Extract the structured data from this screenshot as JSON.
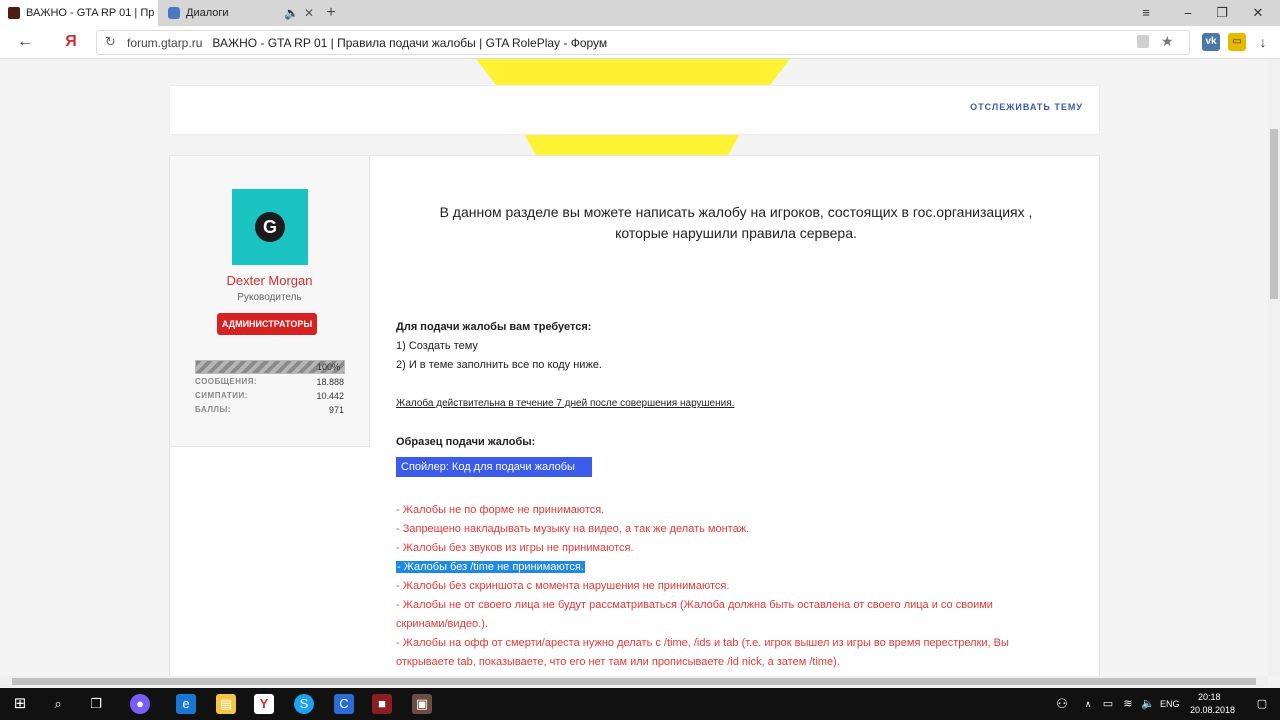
{
  "browser": {
    "tabs": [
      {
        "title": "ВАЖНО - GTA RP 01 | Пр"
      },
      {
        "title": "Диалоги"
      }
    ],
    "new_tab": "+",
    "window": {
      "min": "⎯",
      "restore": "❐",
      "close": "✕",
      "menu": "≡"
    },
    "back": "←",
    "yandex_logo": "Я",
    "url_domain": "forum.gtarp.ru",
    "url_title": "ВАЖНО - GTA RP 01 | Правила подачи жалобы | GTA RolePlay - Форум",
    "download": "↓",
    "ext_vk": "vk"
  },
  "page": {
    "follow_label": "ОТСЛЕЖИВАТЬ ТЕМУ",
    "author": {
      "name": "Dexter Morgan",
      "role": "Руководитель",
      "badge": "АДМИНИСТРАТОРЫ",
      "avatar_letter": "G",
      "progress_percent": 100,
      "progress_label": "100%",
      "stats": [
        {
          "label": "СООБЩЕНИЯ:",
          "value": "18.888"
        },
        {
          "label": "СИМПАТИИ:",
          "value": "10.442"
        },
        {
          "label": "БАЛЛЫ:",
          "value": "971"
        }
      ]
    },
    "headline_1": "В данном разделе вы можете написать жалобу на игроков, состоящих в гос.организациях ,",
    "headline_2": "которые нарушили правила сервера.",
    "req_title": "Для подачи жалобы вам требуется:",
    "req_1": "1) Создать тему",
    "req_2": "2) И в теме заполнить все по коду ниже.",
    "validity": "Жалоба действительна в течение 7 дней после совершения нарушения.",
    "sample_title": "Образец подачи жалобы:",
    "spoiler": "Спойлер: Код для подачи жалобы",
    "rules": {
      "r1": "- Жалобы не по форме не принимаются.",
      "r2": "- Запрещено накладывать музыку на видео, а так же делать монтаж.",
      "r3": "- Жалобы без звуков из игры не принимаются.",
      "r4": "- Жалобы без /time не принимаются.",
      "r5": "- Жалобы без скриншота с момента нарушения не принимаются.",
      "r6a": "- Жалобы не от своего лица не будут рассматриваться (Жалоба должна быть оставлена от своего лица и со своими",
      "r6b": "скринами/видео.).",
      "r7a": "- Жалобы на офф от смерти/ареста нужно делать с /time, /ids и tab (т.е. игрок вышел из игры во время перестрелки, Вы",
      "r7b": "открываете tab, показываете, что его нет там или прописываете /id nick, а затем /time)."
    }
  },
  "taskbar": {
    "lang": "ENG",
    "time": "20:18",
    "date": "20.08.2018"
  },
  "colors": {
    "accent_blue": "#3b5bb7",
    "author_red": "#d32f2f",
    "rule_red": "#e53935",
    "highlight": "#1e88e5",
    "spoiler": "#3b5bea",
    "yellow": "#fff233"
  }
}
